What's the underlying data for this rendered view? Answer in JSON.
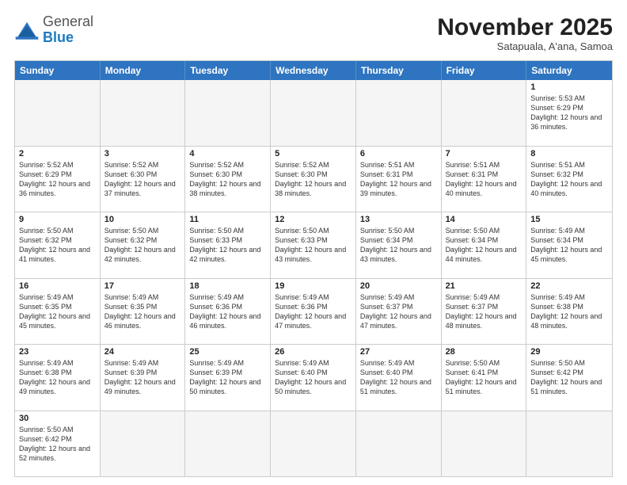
{
  "header": {
    "logo_general": "General",
    "logo_blue": "Blue",
    "title": "November 2025",
    "subtitle": "Satapuala, A'ana, Samoa"
  },
  "weekdays": [
    "Sunday",
    "Monday",
    "Tuesday",
    "Wednesday",
    "Thursday",
    "Friday",
    "Saturday"
  ],
  "rows": [
    [
      {
        "day": "",
        "info": "",
        "empty": true
      },
      {
        "day": "",
        "info": "",
        "empty": true
      },
      {
        "day": "",
        "info": "",
        "empty": true
      },
      {
        "day": "",
        "info": "",
        "empty": true
      },
      {
        "day": "",
        "info": "",
        "empty": true
      },
      {
        "day": "",
        "info": "",
        "empty": true
      },
      {
        "day": "1",
        "info": "Sunrise: 5:53 AM\nSunset: 6:29 PM\nDaylight: 12 hours and 36 minutes.",
        "empty": false
      }
    ],
    [
      {
        "day": "2",
        "info": "Sunrise: 5:52 AM\nSunset: 6:29 PM\nDaylight: 12 hours and 36 minutes.",
        "empty": false
      },
      {
        "day": "3",
        "info": "Sunrise: 5:52 AM\nSunset: 6:30 PM\nDaylight: 12 hours and 37 minutes.",
        "empty": false
      },
      {
        "day": "4",
        "info": "Sunrise: 5:52 AM\nSunset: 6:30 PM\nDaylight: 12 hours and 38 minutes.",
        "empty": false
      },
      {
        "day": "5",
        "info": "Sunrise: 5:52 AM\nSunset: 6:30 PM\nDaylight: 12 hours and 38 minutes.",
        "empty": false
      },
      {
        "day": "6",
        "info": "Sunrise: 5:51 AM\nSunset: 6:31 PM\nDaylight: 12 hours and 39 minutes.",
        "empty": false
      },
      {
        "day": "7",
        "info": "Sunrise: 5:51 AM\nSunset: 6:31 PM\nDaylight: 12 hours and 40 minutes.",
        "empty": false
      },
      {
        "day": "8",
        "info": "Sunrise: 5:51 AM\nSunset: 6:32 PM\nDaylight: 12 hours and 40 minutes.",
        "empty": false
      }
    ],
    [
      {
        "day": "9",
        "info": "Sunrise: 5:50 AM\nSunset: 6:32 PM\nDaylight: 12 hours and 41 minutes.",
        "empty": false
      },
      {
        "day": "10",
        "info": "Sunrise: 5:50 AM\nSunset: 6:32 PM\nDaylight: 12 hours and 42 minutes.",
        "empty": false
      },
      {
        "day": "11",
        "info": "Sunrise: 5:50 AM\nSunset: 6:33 PM\nDaylight: 12 hours and 42 minutes.",
        "empty": false
      },
      {
        "day": "12",
        "info": "Sunrise: 5:50 AM\nSunset: 6:33 PM\nDaylight: 12 hours and 43 minutes.",
        "empty": false
      },
      {
        "day": "13",
        "info": "Sunrise: 5:50 AM\nSunset: 6:34 PM\nDaylight: 12 hours and 43 minutes.",
        "empty": false
      },
      {
        "day": "14",
        "info": "Sunrise: 5:50 AM\nSunset: 6:34 PM\nDaylight: 12 hours and 44 minutes.",
        "empty": false
      },
      {
        "day": "15",
        "info": "Sunrise: 5:49 AM\nSunset: 6:34 PM\nDaylight: 12 hours and 45 minutes.",
        "empty": false
      }
    ],
    [
      {
        "day": "16",
        "info": "Sunrise: 5:49 AM\nSunset: 6:35 PM\nDaylight: 12 hours and 45 minutes.",
        "empty": false
      },
      {
        "day": "17",
        "info": "Sunrise: 5:49 AM\nSunset: 6:35 PM\nDaylight: 12 hours and 46 minutes.",
        "empty": false
      },
      {
        "day": "18",
        "info": "Sunrise: 5:49 AM\nSunset: 6:36 PM\nDaylight: 12 hours and 46 minutes.",
        "empty": false
      },
      {
        "day": "19",
        "info": "Sunrise: 5:49 AM\nSunset: 6:36 PM\nDaylight: 12 hours and 47 minutes.",
        "empty": false
      },
      {
        "day": "20",
        "info": "Sunrise: 5:49 AM\nSunset: 6:37 PM\nDaylight: 12 hours and 47 minutes.",
        "empty": false
      },
      {
        "day": "21",
        "info": "Sunrise: 5:49 AM\nSunset: 6:37 PM\nDaylight: 12 hours and 48 minutes.",
        "empty": false
      },
      {
        "day": "22",
        "info": "Sunrise: 5:49 AM\nSunset: 6:38 PM\nDaylight: 12 hours and 48 minutes.",
        "empty": false
      }
    ],
    [
      {
        "day": "23",
        "info": "Sunrise: 5:49 AM\nSunset: 6:38 PM\nDaylight: 12 hours and 49 minutes.",
        "empty": false
      },
      {
        "day": "24",
        "info": "Sunrise: 5:49 AM\nSunset: 6:39 PM\nDaylight: 12 hours and 49 minutes.",
        "empty": false
      },
      {
        "day": "25",
        "info": "Sunrise: 5:49 AM\nSunset: 6:39 PM\nDaylight: 12 hours and 50 minutes.",
        "empty": false
      },
      {
        "day": "26",
        "info": "Sunrise: 5:49 AM\nSunset: 6:40 PM\nDaylight: 12 hours and 50 minutes.",
        "empty": false
      },
      {
        "day": "27",
        "info": "Sunrise: 5:49 AM\nSunset: 6:40 PM\nDaylight: 12 hours and 51 minutes.",
        "empty": false
      },
      {
        "day": "28",
        "info": "Sunrise: 5:50 AM\nSunset: 6:41 PM\nDaylight: 12 hours and 51 minutes.",
        "empty": false
      },
      {
        "day": "29",
        "info": "Sunrise: 5:50 AM\nSunset: 6:42 PM\nDaylight: 12 hours and 51 minutes.",
        "empty": false
      }
    ],
    [
      {
        "day": "30",
        "info": "Sunrise: 5:50 AM\nSunset: 6:42 PM\nDaylight: 12 hours and 52 minutes.",
        "empty": false
      },
      {
        "day": "",
        "info": "",
        "empty": true
      },
      {
        "day": "",
        "info": "",
        "empty": true
      },
      {
        "day": "",
        "info": "",
        "empty": true
      },
      {
        "day": "",
        "info": "",
        "empty": true
      },
      {
        "day": "",
        "info": "",
        "empty": true
      },
      {
        "day": "",
        "info": "",
        "empty": true
      }
    ]
  ]
}
